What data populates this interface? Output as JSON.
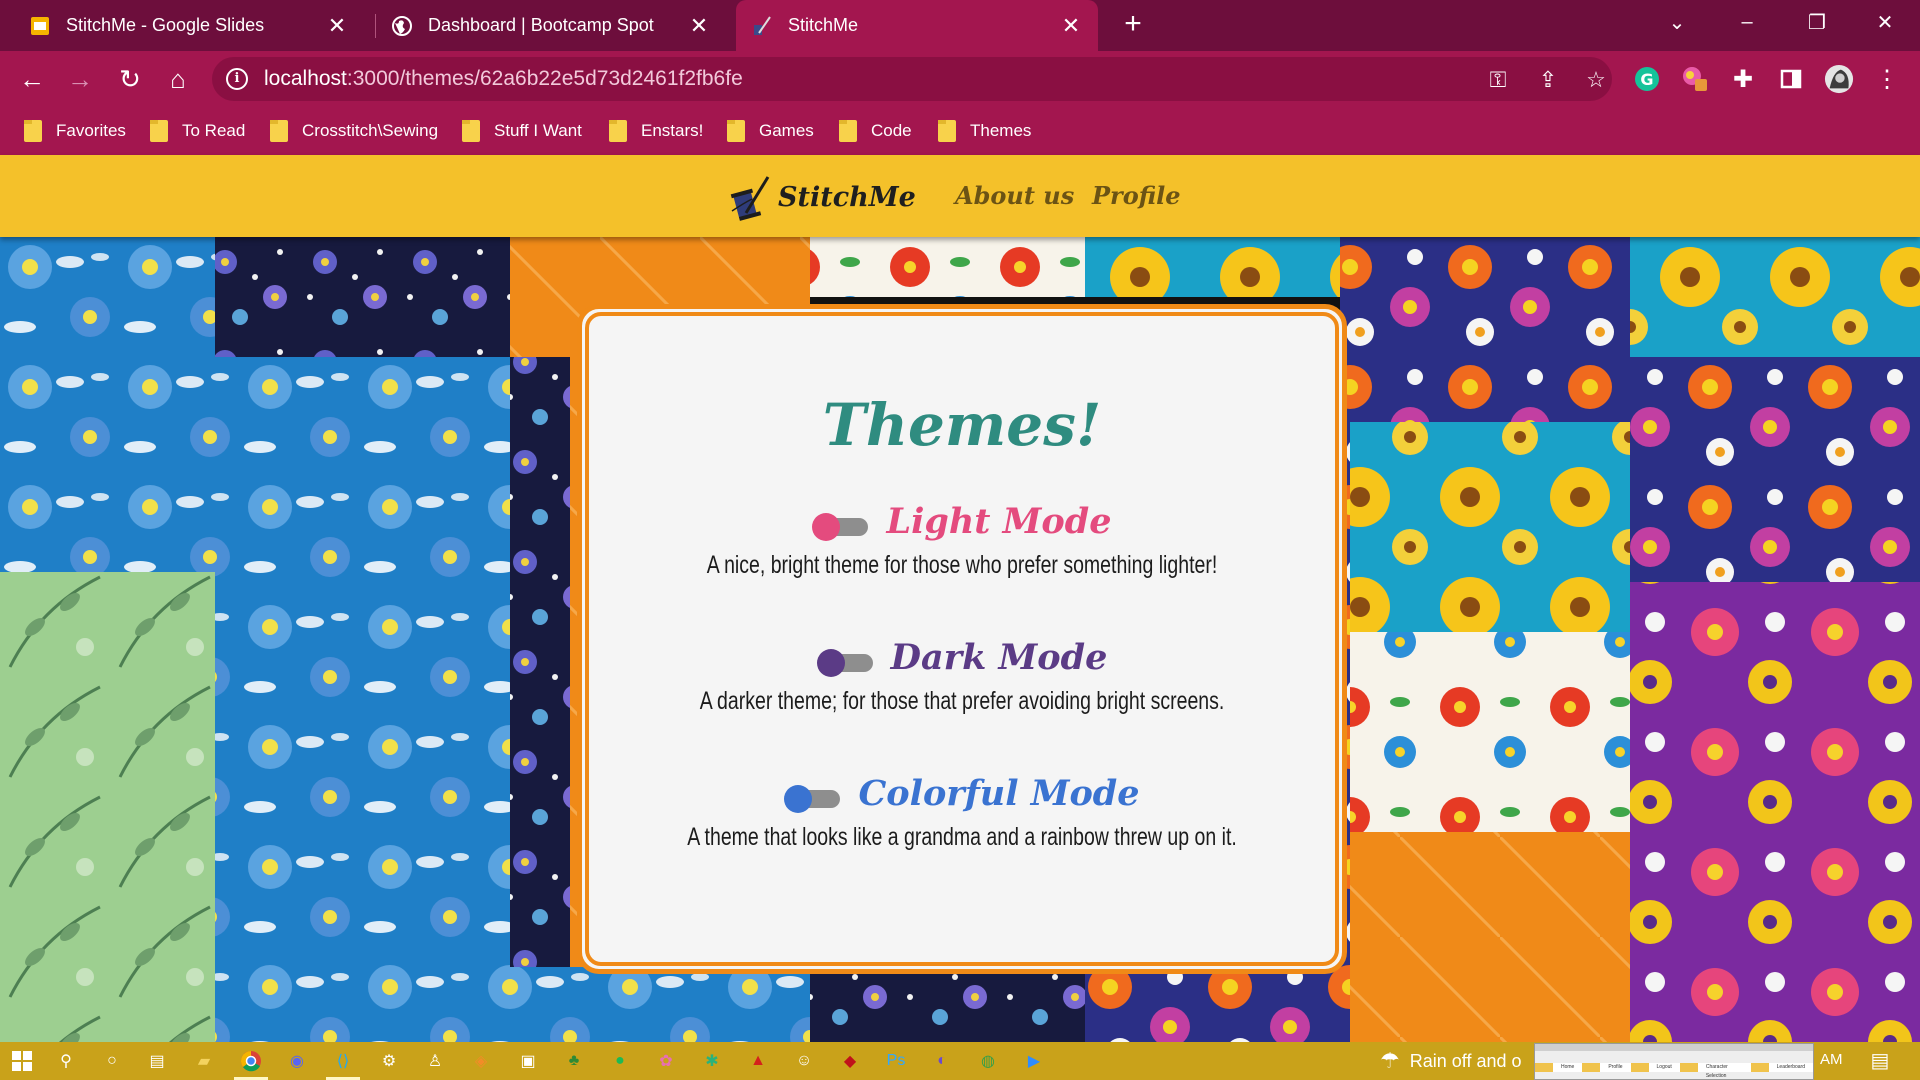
{
  "browser": {
    "tabs": [
      {
        "title": "StitchMe - Google Slides",
        "active": false
      },
      {
        "title": "Dashboard | Bootcamp Spot",
        "active": false
      },
      {
        "title": "StitchMe",
        "active": true
      }
    ],
    "address": {
      "host": "localhost",
      "path": ":3000/themes/62a6b22e5d73d2461f2fb6fe"
    },
    "bookmarks": [
      "Favorites",
      "To Read",
      "Crosstitch\\Sewing",
      "Stuff I Want",
      "Enstars!",
      "Games",
      "Code",
      "Themes"
    ]
  },
  "site": {
    "brand": "StitchMe",
    "nav": [
      "About us",
      "Profile"
    ],
    "header_color": "#f4c12a"
  },
  "themes": {
    "title": "Themes!",
    "modes": [
      {
        "name": "Light Mode",
        "description": "A nice, bright theme for those who prefer something lighter!",
        "color": "#e44b7e"
      },
      {
        "name": "Dark Mode",
        "description": "A darker theme; for those that prefer avoiding bright screens.",
        "color": "#5b3b86"
      },
      {
        "name": "Colorful Mode",
        "description": "A theme that looks like a grandma and a rainbow threw up on it.",
        "color": "#3a73d1"
      }
    ]
  },
  "taskbar": {
    "weather": "Rain off and o",
    "clock": "AM",
    "thumbnail_nav": [
      "Home",
      "Profile",
      "Logout",
      "Character Selection",
      "Leaderboard"
    ]
  }
}
